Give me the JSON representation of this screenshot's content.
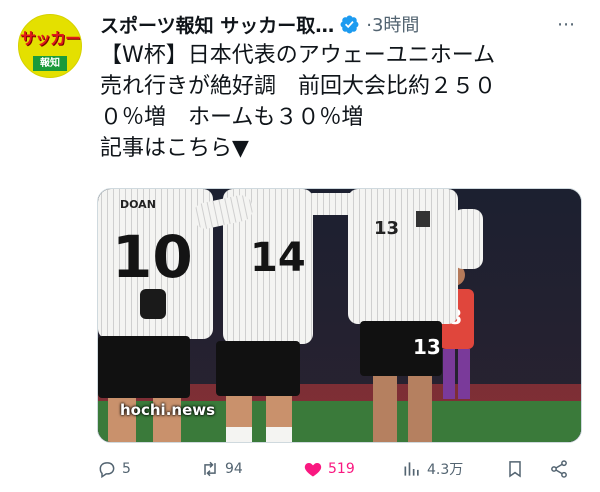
{
  "avatar": {
    "logo_text": "サッカー",
    "logo_sub": "報知"
  },
  "tweet": {
    "author": "スポーツ報知 サッカー取…",
    "separator": "·",
    "time": "3時間",
    "more": "⋯",
    "lines": [
      "【W杯】日本代表のアウェーユニホーム",
      "売れ行きが絶好調　前回大会比約２５０",
      "０％増　ホームも３０％増",
      "記事はこちら▼"
    ]
  },
  "media": {
    "watermark": "hochi.news",
    "jerseys": {
      "left_name": "DOAN",
      "left_number": "10",
      "middle_number": "14",
      "right_chest_number": "13",
      "right_shorts_number": "13",
      "opponent_number": "8"
    }
  },
  "actions": {
    "replies": "5",
    "reposts": "94",
    "likes": "519",
    "views": "4.3万"
  },
  "colors": {
    "like_active": "#f91880",
    "verified": "#1d9bf0",
    "muted": "#536471"
  },
  "icons": [
    "reply-icon",
    "repost-icon",
    "heart-icon",
    "views-icon",
    "bookmark-icon",
    "share-icon",
    "verified-icon",
    "more-icon"
  ]
}
